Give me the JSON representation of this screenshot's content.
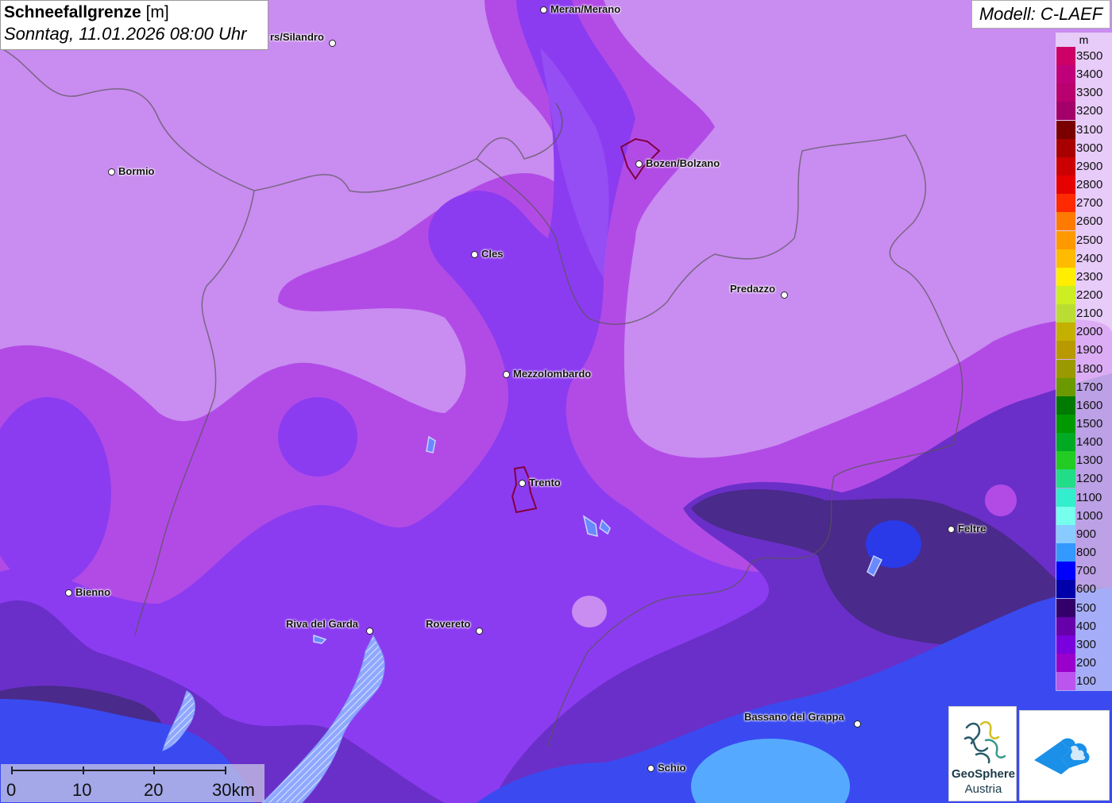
{
  "title": {
    "main": "Schneefallgrenze",
    "unit": "[m]",
    "date": "Sonntag, 11.01.2026 08:00 Uhr"
  },
  "model": "Modell: C-LAEF",
  "legend": {
    "unit": "m",
    "levels": [
      {
        "label": "3500",
        "color": "#cc0066"
      },
      {
        "label": "3400",
        "color": "#c0007a"
      },
      {
        "label": "3300",
        "color": "#b8006e"
      },
      {
        "label": "3200",
        "color": "#a3006a"
      },
      {
        "label": "3100",
        "color": "#7a0000"
      },
      {
        "label": "3000",
        "color": "#a80000"
      },
      {
        "label": "2900",
        "color": "#cc0000"
      },
      {
        "label": "2800",
        "color": "#e60000"
      },
      {
        "label": "2700",
        "color": "#ff2a00"
      },
      {
        "label": "2600",
        "color": "#ff7a00"
      },
      {
        "label": "2500",
        "color": "#ff9900"
      },
      {
        "label": "2400",
        "color": "#ffbb00"
      },
      {
        "label": "2300",
        "color": "#ffee00"
      },
      {
        "label": "2200",
        "color": "#ccee22"
      },
      {
        "label": "2100",
        "color": "#bbdd33"
      },
      {
        "label": "2000",
        "color": "#c4b000"
      },
      {
        "label": "1900",
        "color": "#b89a00"
      },
      {
        "label": "1800",
        "color": "#9a9a00"
      },
      {
        "label": "1700",
        "color": "#6a9a00"
      },
      {
        "label": "1600",
        "color": "#007a00"
      },
      {
        "label": "1500",
        "color": "#009900"
      },
      {
        "label": "1400",
        "color": "#00aa22"
      },
      {
        "label": "1300",
        "color": "#22cc22"
      },
      {
        "label": "1200",
        "color": "#22dd88"
      },
      {
        "label": "1100",
        "color": "#33eecc"
      },
      {
        "label": "1000",
        "color": "#77ffee"
      },
      {
        "label": "900",
        "color": "#88ccff"
      },
      {
        "label": "800",
        "color": "#3399ff"
      },
      {
        "label": "700",
        "color": "#0000ff"
      },
      {
        "label": "600",
        "color": "#0000aa"
      },
      {
        "label": "500",
        "color": "#33006a"
      },
      {
        "label": "400",
        "color": "#6600aa"
      },
      {
        "label": "300",
        "color": "#7a00dd"
      },
      {
        "label": "200",
        "color": "#9900cc"
      },
      {
        "label": "100",
        "color": "#bb55ee"
      }
    ]
  },
  "cities": [
    {
      "name": "Meran/Merano"
    },
    {
      "name": "rs/Silandro"
    },
    {
      "name": "Bozen/Bolzano"
    },
    {
      "name": "Bormio"
    },
    {
      "name": "Cles"
    },
    {
      "name": "Predazzo"
    },
    {
      "name": "Mezzolombardo"
    },
    {
      "name": "Trento"
    },
    {
      "name": "Feltre"
    },
    {
      "name": "Bienno"
    },
    {
      "name": "Riva del Garda"
    },
    {
      "name": "Rovereto"
    },
    {
      "name": "Bassano del Grappa"
    },
    {
      "name": "Schio"
    }
  ],
  "scale": {
    "labels": [
      "0",
      "10",
      "20",
      "30km"
    ]
  },
  "logos": {
    "geosphere_line1": "GeoSphere",
    "geosphere_line2": "Austria"
  }
}
